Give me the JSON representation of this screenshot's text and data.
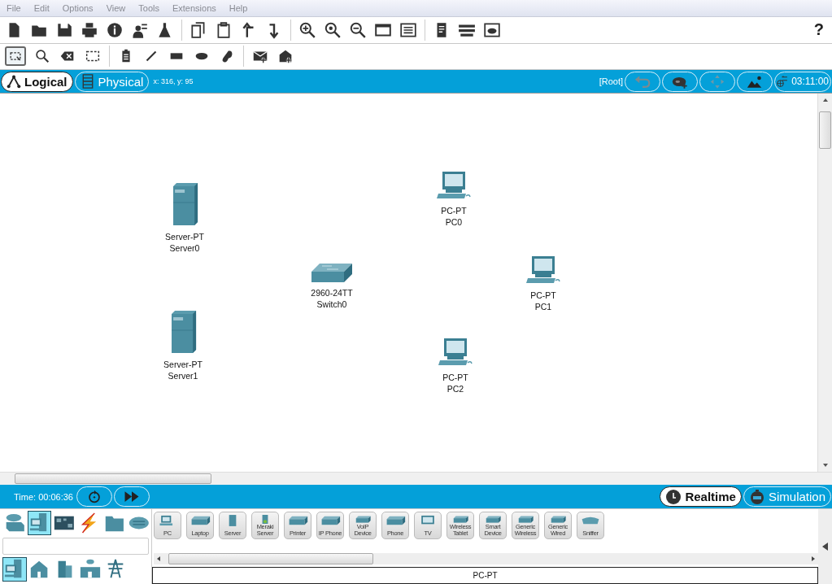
{
  "menu": [
    "File",
    "Edit",
    "Options",
    "View",
    "Tools",
    "Extensions",
    "Help"
  ],
  "help_button": "?",
  "edit_tools": [
    {
      "selected": true
    },
    {
      "selected": false
    },
    {
      "selected": false
    },
    {
      "selected": false
    },
    {
      "selected": false
    },
    {
      "selected": false
    },
    {
      "selected": false
    },
    {
      "selected": false
    },
    {
      "selected": false
    },
    {
      "selected": false
    },
    {
      "selected": false
    }
  ],
  "workspace_tabs": [
    {
      "label": "Logical",
      "selected": true
    },
    {
      "label": "Physical",
      "selected": false
    }
  ],
  "cursor_position": "x: 316, y: 95",
  "path": "[Root]",
  "clock": "03:11:00",
  "devices": [
    {
      "kind": "server",
      "model": "Server-PT",
      "name": "Server0"
    },
    {
      "kind": "pc",
      "model": "PC-PT",
      "name": "PC0"
    },
    {
      "kind": "switch",
      "model": "2960-24TT",
      "name": "Switch0"
    },
    {
      "kind": "pc",
      "model": "PC-PT",
      "name": "PC1"
    },
    {
      "kind": "server",
      "model": "Server-PT",
      "name": "Server1"
    },
    {
      "kind": "pc",
      "model": "PC-PT",
      "name": "PC2"
    }
  ],
  "sim_time": "Time: 00:06:36",
  "modes": [
    {
      "label": "Realtime",
      "selected": true
    },
    {
      "label": "Simulation",
      "selected": false
    }
  ],
  "categories": [
    {
      "selected": false
    },
    {
      "selected": true
    },
    {
      "selected": false
    },
    {
      "selected": false
    },
    {
      "selected": false
    },
    {
      "selected": false
    }
  ],
  "subcategories": [
    {
      "selected": true
    },
    {
      "selected": false
    },
    {
      "selected": false
    },
    {
      "selected": false
    },
    {
      "selected": false
    }
  ],
  "device_palette": [
    "PC",
    "Laptop",
    "Server",
    "Meraki Server",
    "Printer",
    "IP Phone",
    "VoIP Device",
    "Phone",
    "TV",
    "Wireless Tablet",
    "Smart Device",
    "Generic Wireless",
    "Generic Wired",
    "Sniffer"
  ],
  "selected_device": "PC-PT"
}
